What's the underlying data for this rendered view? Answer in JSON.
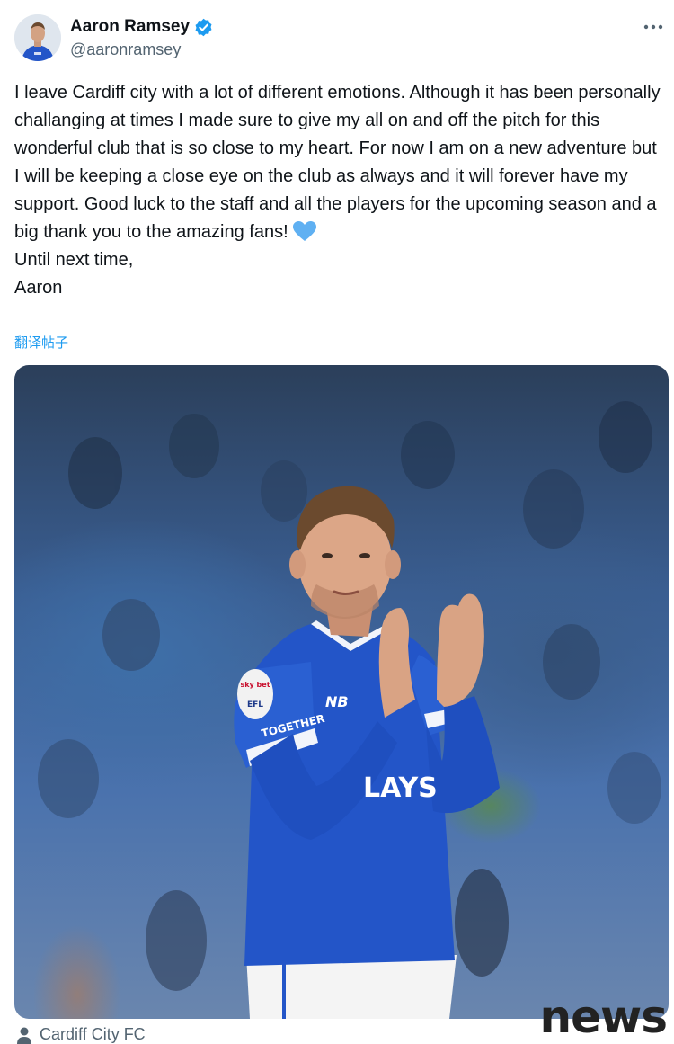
{
  "author": {
    "display_name": "Aaron Ramsey",
    "handle": "@aaronramsey",
    "verified": true,
    "avatar_icon": "player-avatar"
  },
  "more_icon": "more-dots-icon",
  "tweet": {
    "body_paragraph": "I leave Cardiff city with a lot of different emotions. Although it has been personally challanging at times I made sure to give my all on and off the pitch for this wonderful club that is so close to my heart. For now I am on a new adventure but I will be keeping a close eye on the club as always and it will forever have my support. Good luck to the staff and all the players for the upcoming season and a big thank you to the amazing fans!",
    "emoji": "blue-heart",
    "sign_off": "Until next time,",
    "signature": "Aaron"
  },
  "translate_link": "翻译帖子",
  "media": {
    "jersey_text": "LAYS",
    "sleeve_text": "TOGETHER",
    "badge_text": "sky bet EFL",
    "brand": "NB"
  },
  "photo_credit": {
    "icon": "person-icon",
    "label": "Cardiff City FC"
  },
  "watermark": "news",
  "colors": {
    "text": "#0f1419",
    "secondary": "#536471",
    "link": "#1d9bf0",
    "verified": "#1d9bf0",
    "heart": "#5fb0f2",
    "jersey": "#2355c8"
  }
}
